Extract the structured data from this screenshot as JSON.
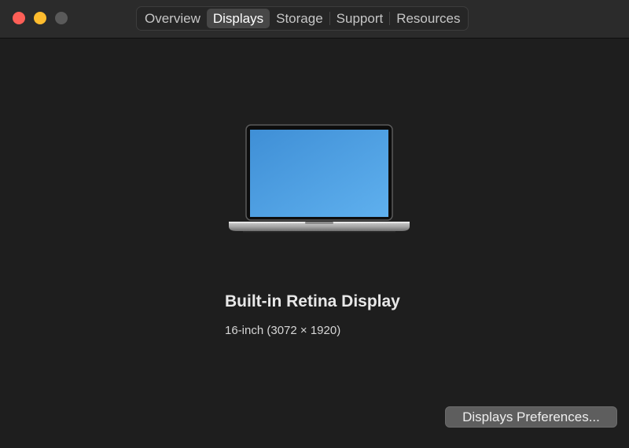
{
  "window": {
    "traffic_lights": [
      "close",
      "minimize",
      "zoom"
    ]
  },
  "tabs": [
    {
      "label": "Overview",
      "selected": false
    },
    {
      "label": "Displays",
      "selected": true
    },
    {
      "label": "Storage",
      "selected": false
    },
    {
      "label": "Support",
      "selected": false
    },
    {
      "label": "Resources",
      "selected": false
    }
  ],
  "display": {
    "icon": "laptop-icon",
    "name": "Built-in Retina Display",
    "spec": "16-inch (3072 × 1920)"
  },
  "actions": {
    "preferences_label": "Displays Preferences..."
  },
  "colors": {
    "background": "#1e1e1e",
    "titlebar": "#2b2b2b",
    "close": "#fe5f57",
    "minimize": "#febc2e",
    "zoom_inactive": "#5a5a5a",
    "screen_blue": "#4d9fe3"
  }
}
